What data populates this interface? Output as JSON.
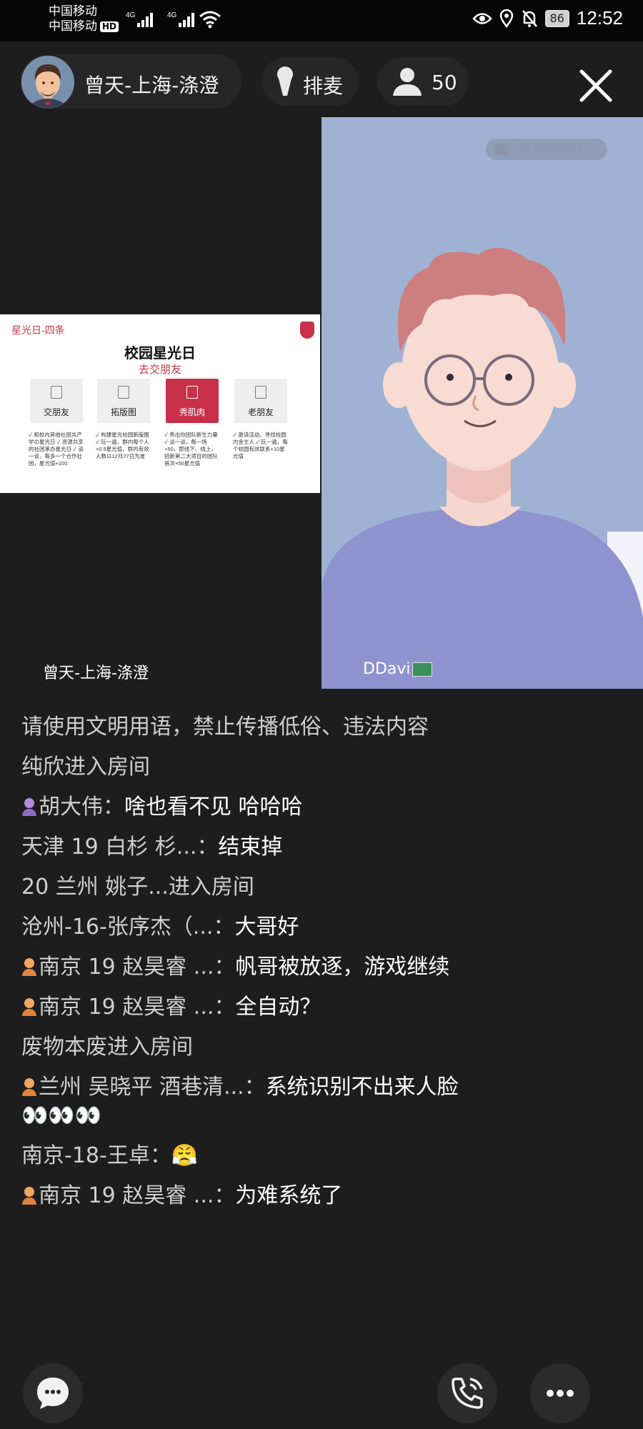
{
  "status_bar": {
    "carrier_1": "中国移动",
    "carrier_2": "中国移动",
    "hd_badge": "HD",
    "network_1": "4G",
    "network_2": "4G",
    "battery": "86",
    "time": "12:52"
  },
  "header": {
    "host_name": "曾天-上海-涤澄",
    "queue_label": "排麦",
    "viewer_count": "50"
  },
  "video": {
    "room_id": "ID:8199081",
    "left_cam_name": "曾天-上海-涤澄",
    "right_cam_name": "DDavi"
  },
  "slide": {
    "tag": "星光日-四条",
    "title": "校园星光日",
    "subtitle": "去交朋友",
    "cards": [
      {
        "label": "交朋友",
        "text": "✓ 和校内其他社团共产学の星光日 ✓ 资源共享的社团承办星光日 ✓ 谈一谈，每多一个合作社团，星光值+100"
      },
      {
        "label": "拓版图",
        "text": "✓ 构建星光校园新版图 ✓ 玩一遍，群内每个人+0.5星光值，群内有效人数以12月27日为准"
      },
      {
        "label": "秀肌肉",
        "text": "✓ 秀出你团队新生力量 ✓ 谈一谈，每一场+50，即线下、线上，招新第二大项目的团队首次+50星光值"
      },
      {
        "label": "老朋友",
        "text": "✓ 邀请活动，寻找校园内金主人 ✓ 玩一遍，每个校园有效联系+10星光值"
      }
    ]
  },
  "chat": [
    {
      "type": "system",
      "text": "请使用文明用语，禁止传播低俗、违法内容"
    },
    {
      "type": "system",
      "text": "纯欣进入房间"
    },
    {
      "type": "message",
      "icon": "purple",
      "nick": "胡大伟：",
      "text": "啥也看不见 哈哈哈"
    },
    {
      "type": "message",
      "icon": "",
      "nick": "天津 19 白杉 杉...：",
      "text": "结束掉"
    },
    {
      "type": "system",
      "text": "20  兰州  姚子...进入房间"
    },
    {
      "type": "message",
      "icon": "",
      "nick": "沧州-16-张序杰（...：",
      "text": "大哥好"
    },
    {
      "type": "message",
      "icon": "orange",
      "nick": "南京 19 赵昊睿 ...：",
      "text": "帆哥被放逐，游戏继续"
    },
    {
      "type": "message",
      "icon": "orange",
      "nick": "南京 19 赵昊睿 ...：",
      "text": "全自动？"
    },
    {
      "type": "system",
      "text": "废物本废进入房间"
    },
    {
      "type": "message",
      "icon": "orange",
      "nick": "兰州 吴晓平 酒巷清...：",
      "text": "系统识别不出来人脸👀👀👀"
    },
    {
      "type": "message",
      "icon": "",
      "nick": "南京-18-王卓：",
      "text": "😤"
    },
    {
      "type": "message",
      "icon": "orange",
      "nick": "南京 19 赵昊睿 ...：",
      "text": "为难系统了"
    }
  ],
  "colors": {
    "background": "#1d1d1d",
    "pill": "#262626",
    "video_bg": "#9fb1d2",
    "accent_red": "#c9314a"
  },
  "icons": [
    "signal-icon",
    "wifi-icon",
    "eye-icon",
    "location-icon",
    "mute-bell-icon",
    "mic-icon",
    "user-icon",
    "close-icon",
    "room-id-camera-icon",
    "chat-bubble-icon",
    "phone-icon",
    "more-icon"
  ]
}
